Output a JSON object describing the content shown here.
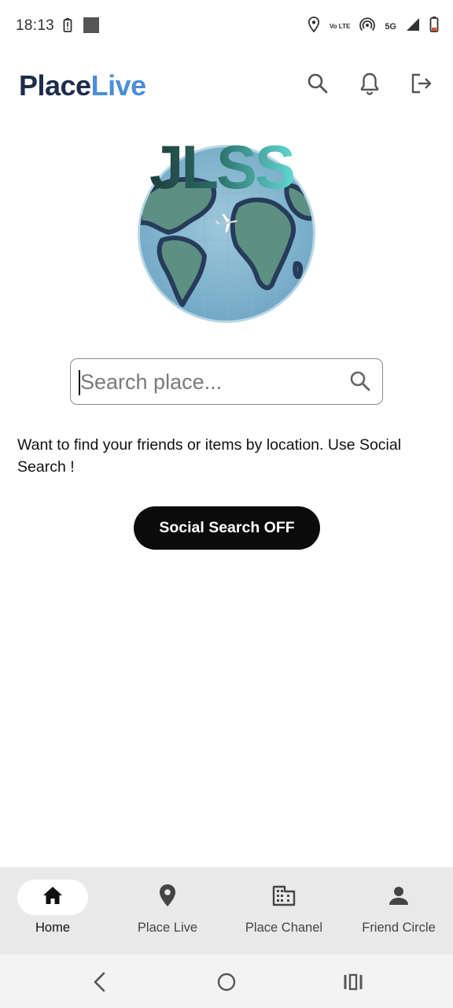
{
  "status_bar": {
    "time": "18:13",
    "network": "5G",
    "volte": "Vo LTE"
  },
  "app_bar": {
    "brand_part1": "Place",
    "brand_part2": "Live",
    "brand_color_1": "#1d2d4a",
    "brand_color_2": "#4a8fd6",
    "icons": [
      "search-icon",
      "bell-icon",
      "logout-icon"
    ]
  },
  "logo": {
    "text": "JLSS"
  },
  "search": {
    "placeholder": "Search place...",
    "value": ""
  },
  "info_text": "Want to find your friends or items by location. Use Social Search !",
  "social_button": {
    "label": "Social Search OFF"
  },
  "bottom_nav": {
    "items": [
      {
        "label": "Home",
        "icon": "home-icon",
        "active": true
      },
      {
        "label": "Place Live",
        "icon": "location-pin-icon",
        "active": false
      },
      {
        "label": "Place Chanel",
        "icon": "building-icon",
        "active": false
      },
      {
        "label": "Friend Circle",
        "icon": "person-icon",
        "active": false
      }
    ]
  },
  "system_nav": {
    "icons": [
      "back-icon",
      "home-circle-icon",
      "recents-icon"
    ]
  }
}
